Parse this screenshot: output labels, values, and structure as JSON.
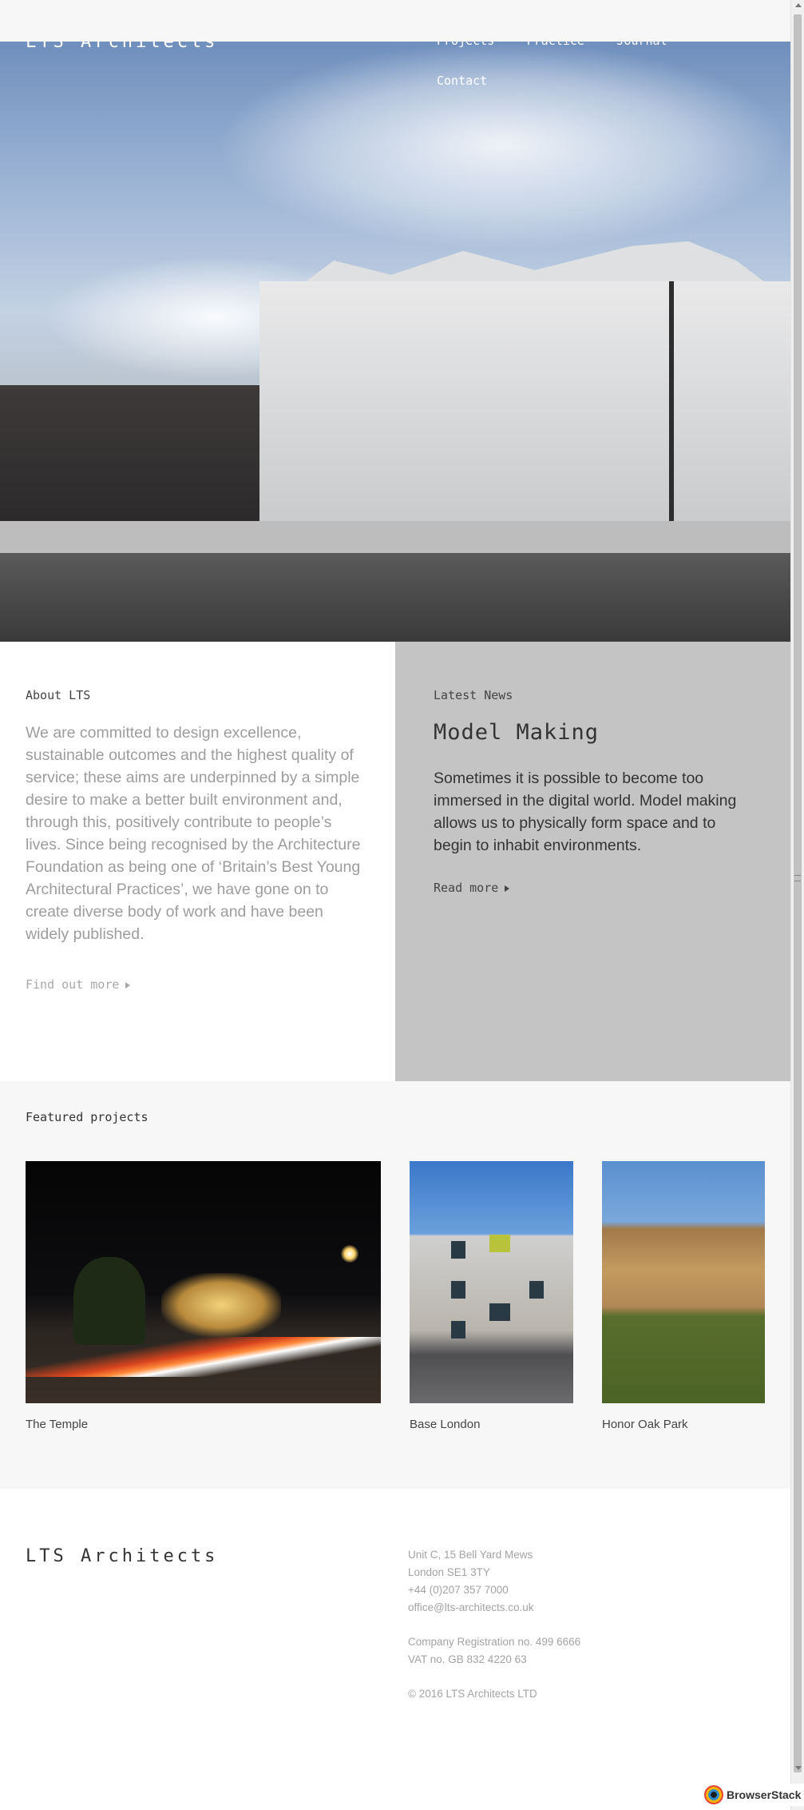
{
  "header": {
    "logo": "LTS Architects",
    "nav": [
      "Projects",
      "Practice",
      "Journal",
      "Contact"
    ]
  },
  "about": {
    "heading": "About LTS",
    "body": "We are committed to design excellence, sustainable outcomes and the highest quality of service; these aims are underpinned by a simple desire to make a better built environment and, through this, positively contribute to people’s lives. Since being recognised by the Architecture Foundation as being one of ‘Britain’s Best Young Architectural Practices’, we have gone on to create diverse body of work and have been widely published.",
    "link": "Find out more"
  },
  "news": {
    "heading": "Latest News",
    "title": "Model Making",
    "body": "Sometimes it is possible to become too immersed in the digital world. Model making allows us to physically form space and to begin to inhabit environments.",
    "link": "Read more"
  },
  "featured": {
    "heading": "Featured projects",
    "projects": [
      {
        "name": "The Temple"
      },
      {
        "name": "Base London"
      },
      {
        "name": "Honor Oak Park"
      }
    ]
  },
  "footer": {
    "logo": "LTS Architects",
    "address": [
      "Unit C, 15 Bell Yard Mews",
      "London SE1 3TY",
      "+44 (0)207 357 7000",
      "office@lts-architects.co.uk"
    ],
    "registration": [
      "Company Registration no. 499 6666",
      "VAT no. GB 832 4220 63"
    ],
    "copyright": "© 2016 LTS Architects LTD"
  },
  "badge": {
    "label": "BrowserStack"
  },
  "icons": {
    "arrow": "triangle-right-icon",
    "scroll_up": "arrow-up-icon",
    "scroll_down": "arrow-down-icon"
  }
}
